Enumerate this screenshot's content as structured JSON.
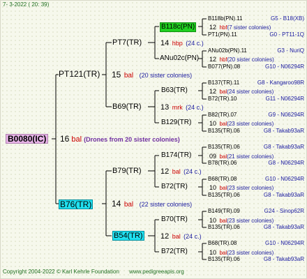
{
  "header": {
    "date": "7-  3-2022 ( 20: 39)"
  },
  "root": {
    "name": "B0080(IC)",
    "num": "16",
    "code": "bal",
    "note": "(Drones from 20 sister colonies)"
  },
  "gen1": [
    {
      "name": "PT121(TR)",
      "num": "15",
      "code": "bal",
      "note": "(20 sister colonies)"
    },
    {
      "name": "B76(TR)",
      "num": "14",
      "code": "bal",
      "note": "(22 sister colonies)"
    }
  ],
  "gen2": [
    {
      "name": "PT7(TR)",
      "num": "14",
      "code": "hbp",
      "note": "(24 c.)"
    },
    {
      "name": "B69(TR)",
      "num": "13",
      "code": "mrk",
      "note": "(24 c.)"
    },
    {
      "name": "B79(TR)",
      "num": "12",
      "code": "bal",
      "note": "(24 c.)"
    },
    {
      "name": "B54(TR)",
      "num": "12",
      "code": "bal",
      "note": "(24 c.)"
    }
  ],
  "gen3": [
    {
      "name": "B118c(PN)",
      "num": "12",
      "code": "hbf",
      "note": "(7 sister colonies)"
    },
    {
      "name": "ANu02c(PN)",
      "num": "12",
      "code": "hbf",
      "note": "(20 sister colonies)"
    },
    {
      "name": "B63(TR)",
      "num": "12",
      "code": "bal",
      "note": "(24 sister colonies)"
    },
    {
      "name": "B129(TR)",
      "num": "10",
      "code": "bal",
      "note": "(23 sister colonies)"
    },
    {
      "name": "B174(TR)",
      "num": "09",
      "code": "bal",
      "note": "(21 sister colonies)"
    },
    {
      "name": "B72(TR)",
      "num": "10",
      "code": "bal",
      "note": "(23 sister colonies)"
    },
    {
      "name": "B70(TR)",
      "num": "10",
      "code": "bal",
      "note": "(23 sister colonies)"
    },
    {
      "name": "B72(TR)",
      "num": "10",
      "code": "bal",
      "note": "(23 sister colonies)"
    }
  ],
  "gen4": [
    {
      "name": "B118b(PN).11",
      "code": "G5 - B18(XB)"
    },
    {
      "name": "PT1(PN).11",
      "code": "G0 - PT11-1Q"
    },
    {
      "name": "ANu02b(PN).11",
      "code": "G3 - NuriQ"
    },
    {
      "name": "B077(PN).08",
      "code": "G10 - N06294R"
    },
    {
      "name": "B137(TR).11",
      "code": "G8 - Kangaroo98R"
    },
    {
      "name": "B72(TR).10",
      "code": "G11 - N06294R"
    },
    {
      "name": "B82(TR).07",
      "code": "G9 - N06294R"
    },
    {
      "name": "B135(TR).06",
      "code": "G8 - Takab93aR"
    },
    {
      "name": "B135(TR).06",
      "code": "G8 - Takab93aR"
    },
    {
      "name": "B78(TR).06",
      "code": "G8 - N06294R"
    },
    {
      "name": "B68(TR).08",
      "code": "G10 - N06294R"
    },
    {
      "name": "B135(TR).06",
      "code": "G8 - Takab93aR"
    },
    {
      "name": "B149(TR).09",
      "code": "G24 - Sinop62R"
    },
    {
      "name": "B135(TR).06",
      "code": "G8 - Takab93aR"
    },
    {
      "name": "B68(TR).08",
      "code": "G10 - N06294R"
    },
    {
      "name": "B135(TR).06",
      "code": "G8 - Takab93aR"
    }
  ],
  "footer": {
    "copyright": "Copyright 2004-2022 © Karl Kehrle Foundation",
    "site": "www.pedigreeapis.org"
  },
  "colors": {
    "root_highlight": "#e8b4e8",
    "green_highlight": "#20d020",
    "cyan_highlight": "#20e0f0",
    "num_red": "#cc0000",
    "code_blue": "#2020a0",
    "footer_green": "#207020"
  }
}
